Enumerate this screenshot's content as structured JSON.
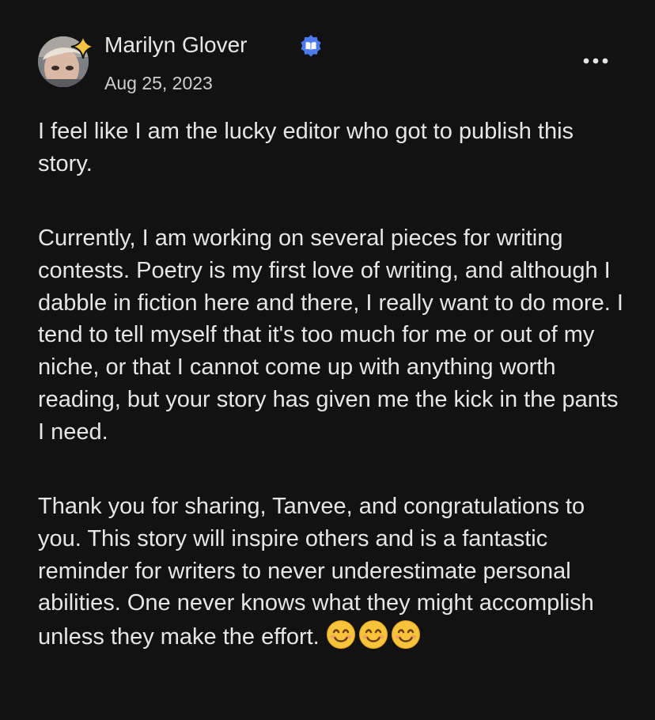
{
  "author": {
    "name": "Marilyn Glover",
    "date": "Aug 25, 2023",
    "avatar_icon": "avatar-photo",
    "badge_icon": "sparkle-icon",
    "verified_icon": "verified-book-badge-icon"
  },
  "menu": {
    "icon": "more-options-icon"
  },
  "comment": {
    "paragraphs": [
      "I feel like I am the lucky editor who got to publish this story.",
      "Currently, I am working on several pieces for writing contests. Poetry is my first love of writing, and although I dabble in fiction here and there, I really want to do more. I tend to tell myself that it's too much for me or out of my niche, or that I cannot come up with anything worth reading, but your story has given me the kick in the pants I need.",
      "Thank you for sharing, Tanvee, and congratulations to you. This story will inspire others and is a fantastic reminder for writers to never underestimate personal abilities. One never knows what they might accomplish unless they make the effort."
    ],
    "emojis": [
      "smiling-face-emoji",
      "smiling-face-emoji",
      "smiling-face-emoji"
    ]
  },
  "colors": {
    "background": "#121212",
    "text": "#e6e6e6",
    "verified_badge": "#4b7bec",
    "sparkle": "#f5c542"
  }
}
